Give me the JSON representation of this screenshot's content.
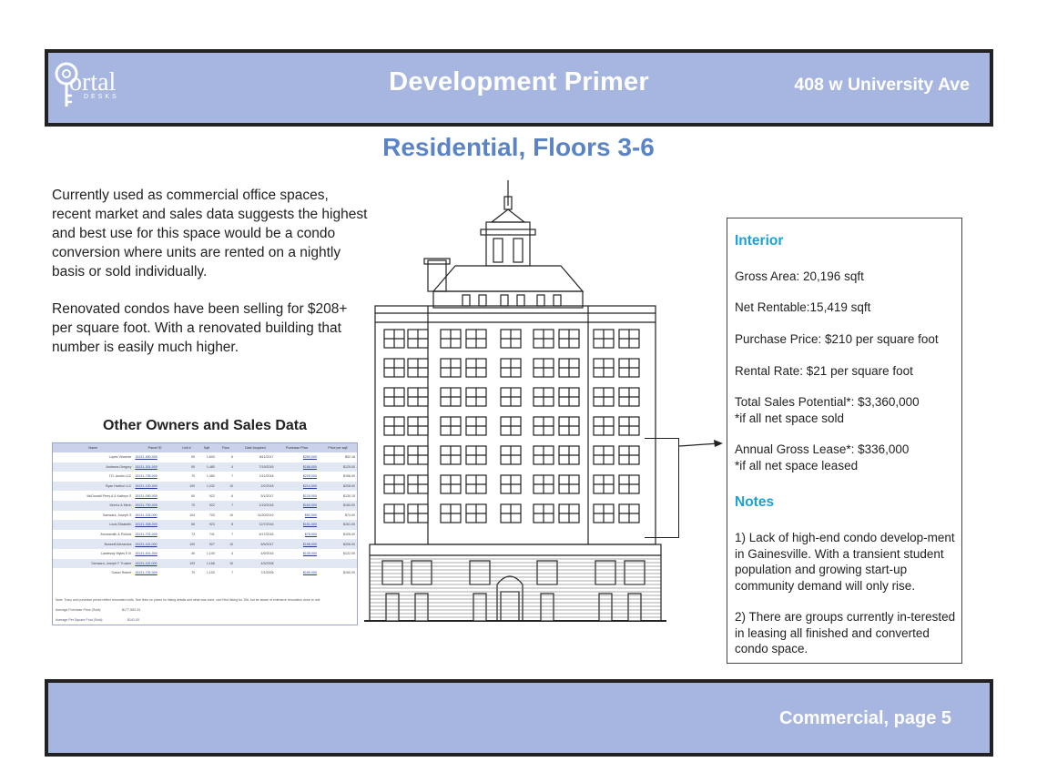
{
  "header": {
    "logo_text": "ortal",
    "logo_sub": "DESKS",
    "title": "Development Primer",
    "address": "408 w University Ave"
  },
  "section_title": "Residential, Floors 3-6",
  "intro": {
    "paragraph_1": "Currently used as commercial office spaces, recent market and sales data suggests the highest and best use for this space would be a condo conversion where units are rented on a nightly basis or sold individually.",
    "paragraph_2": "Renovated condos have been selling for $208+ per square foot. With a renovated building that number is easily much higher."
  },
  "sales_table": {
    "title": "Other Owners and Sales Data",
    "columns": [
      "Name",
      "Parcel ID",
      "Unit #",
      "Sqft",
      "Floor",
      "Date Acquired",
      "Purchase Price",
      "Price per sqft"
    ],
    "rows": [
      [
        "Lopez Vincente",
        "15131-900-000",
        "90",
        "1,600",
        "6",
        "8/11/2017",
        "$283,000",
        "$92.18"
      ],
      [
        "Andrews Gregory",
        "15131-301-000",
        "90",
        "1,480",
        "4",
        "7/19/2016",
        "$188,000",
        "$125.00"
      ],
      [
        "T.D. Austin LLC",
        "15131-735-000",
        "70",
        "1,480",
        "7",
        "1/11/2018",
        "$228,000",
        "$156.00"
      ],
      [
        "Ryan Hartkol LLC",
        "15131-120-000",
        "100",
        "1,032",
        "10",
        "2/2/2018",
        "$214,500",
        "$208.00"
      ],
      [
        "McDonald Perry A & Kathryn S",
        "15131-090-000",
        "60",
        "922",
        "6",
        "5/1/2017",
        "$120,000",
        "$130.15"
      ],
      [
        "Mont'a & Mirch",
        "15131-790-000",
        "70",
        "922",
        "7",
        "1/19/2018",
        "$163,000",
        "$180.00"
      ],
      [
        "Samsara, Joseph S",
        "15131-115-000",
        "104",
        "703",
        "10",
        "11/20/2019",
        "$52,000",
        "$74.00"
      ],
      [
        "Louis Elizabeth",
        "15131-308-000",
        "80",
        "923",
        "8",
        "12/7/2016",
        "$151,000",
        "$161.00"
      ],
      [
        "Arrowsmith & Pollock",
        "15131-701-000",
        "73",
        "741",
        "7",
        "6/17/2016",
        "$78,000",
        "$105.00"
      ],
      [
        "Bussetti Alexandra",
        "15131-110-000",
        "100",
        "927",
        "10",
        "6/9/2017",
        "$198,000",
        "$206.00"
      ],
      [
        "Lawlessly Myles E III",
        "15131-401-000",
        "40",
        "1,100",
        "4",
        "4/9/2016",
        "$135,000",
        "$122.00"
      ],
      [
        "Samsara, Joseph F Trustee",
        "15131-110-000",
        "109",
        "1,168",
        "10",
        "4/3/2008",
        "",
        ""
      ],
      [
        "Susan Robert",
        "15131-702-000",
        "70",
        "1,100",
        "7",
        "7/1/2005",
        "$165,000",
        "$150.00"
      ]
    ],
    "note": "Note: Tracy and purchase prices reflect renovated units. See links on prices for listing details and what was done, can't find listing for 106, but be aware of extensive renovation done to unit",
    "avg_purchase_label": "Average Purchase Price (Sold):",
    "avg_purchase_value": "$177,583.33",
    "avg_sqft_label": "Average Per Square Foot (Sold):",
    "avg_sqft_value": "$141.00"
  },
  "info_box": {
    "interior_heading": "Interior",
    "gross_area": "Gross Area: 20,196 sqft",
    "net_rentable": "Net Rentable:15,419 sqft",
    "purchase_price": "Purchase Price: $210 per square foot",
    "rental_rate": "Rental Rate: $21 per square foot",
    "sales_potential": "Total Sales Potential*: $3,360,000",
    "sales_footnote": "*if all net space sold",
    "gross_lease": "Annual Gross Lease*: $336,000",
    "lease_footnote": "*if all net space leased",
    "notes_heading": "Notes",
    "note_1": "1) Lack of high-end condo develop-ment in Gainesville. With a transient student population and growing start-up community demand will only rise.",
    "note_2": "2) There are groups currently in-terested in leasing all finished and converted condo space."
  },
  "footer": {
    "text": "Commercial, page 5"
  },
  "colors": {
    "banner": "#a7b6e0",
    "title_blue": "#5b84c4",
    "heading_cyan": "#1aa1d6"
  }
}
